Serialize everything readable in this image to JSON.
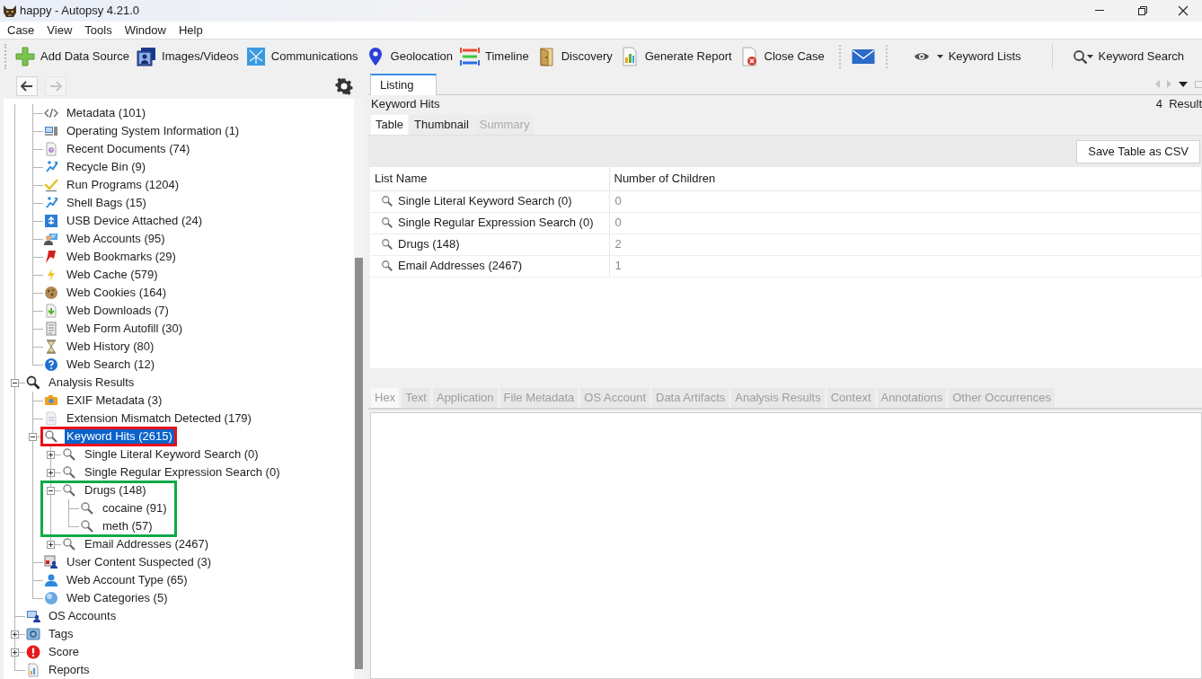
{
  "window": {
    "title": "happy - Autopsy 4.21.0"
  },
  "menu": [
    "Case",
    "View",
    "Tools",
    "Window",
    "Help"
  ],
  "toolbar": {
    "buttons": [
      "Add Data Source",
      "Images/Videos",
      "Communications",
      "Geolocation",
      "Timeline",
      "Discovery",
      "Generate Report",
      "Close Case"
    ],
    "keyword_buttons": [
      "Keyword Lists",
      "Keyword Search"
    ]
  },
  "navigation": {
    "back": {
      "disabled": false
    },
    "forward": {
      "disabled": true
    }
  },
  "tree": {
    "nodes": [
      {
        "children": [
          {
            "label": "Metadata (101)",
            "selected": false
          },
          {
            "label": "Operating System Information (1)",
            "selected": false
          },
          {
            "label": "Recent Documents (74)",
            "selected": false
          },
          {
            "label": "Recycle Bin (9)",
            "selected": false
          },
          {
            "label": "Run Programs (1204)",
            "selected": false
          },
          {
            "label": "Shell Bags (15)",
            "selected": false
          },
          {
            "label": "USB Device Attached (24)",
            "selected": false
          },
          {
            "label": "Web Accounts (95)",
            "selected": false
          },
          {
            "label": "Web Bookmarks (29)",
            "selected": false
          },
          {
            "label": "Web Cache (579)",
            "selected": false
          },
          {
            "label": "Web Cookies (164)",
            "selected": false
          },
          {
            "label": "Web Downloads (7)",
            "selected": false
          },
          {
            "label": "Web Form Autofill (30)",
            "selected": false
          },
          {
            "label": "Web History (80)",
            "selected": false
          },
          {
            "label": "Web Search (12)",
            "selected": false
          }
        ]
      },
      {
        "label": "Analysis Results",
        "expanded": true,
        "selected": false,
        "children": [
          {
            "label": "EXIF Metadata (3)",
            "selected": false
          },
          {
            "label": "Extension Mismatch Detected (179)",
            "selected": false
          },
          {
            "label": "Keyword Hits (2615)",
            "expanded": true,
            "selected": true,
            "annotation_box": {
              "kind": "row",
              "color": "#e8101a"
            },
            "children": [
              {
                "label": "Single Literal Keyword Search (0)",
                "expanded": false,
                "selected": false
              },
              {
                "label": "Single Regular Expression Search (0)",
                "expanded": false,
                "selected": false
              },
              {
                "label": "Drugs (148)",
                "expanded": true,
                "selected": false,
                "annotation_box": {
                  "kind": "branch",
                  "color": "#12a84a"
                },
                "children": [
                  {
                    "label": "cocaine (91)",
                    "selected": false
                  },
                  {
                    "label": "meth (57)",
                    "selected": false
                  }
                ]
              },
              {
                "label": "Email Addresses (2467)",
                "expanded": false,
                "selected": false
              }
            ]
          },
          {
            "label": "User Content Suspected (3)",
            "selected": false
          },
          {
            "label": "Web Account Type (65)",
            "selected": false
          },
          {
            "label": "Web Categories (5)",
            "selected": false
          }
        ]
      },
      {
        "label": "OS Accounts",
        "selected": false
      },
      {
        "label": "Tags",
        "expanded": false,
        "selected": false
      },
      {
        "label": "Score",
        "expanded": false,
        "selected": false
      },
      {
        "label": "Reports",
        "selected": false
      }
    ]
  },
  "listing": {
    "tabs": [
      {
        "label": "Listing",
        "selected": true
      }
    ],
    "title": "Keyword Hits",
    "result_count": "4  Result",
    "view_tabs": [
      {
        "label": "Table",
        "selected": true,
        "disabled": false
      },
      {
        "label": "Thumbnail",
        "selected": false,
        "disabled": false
      },
      {
        "label": "Summary",
        "selected": false,
        "disabled": true
      }
    ],
    "save_button": "Save Table as CSV",
    "table": {
      "columns": [
        "List Name",
        "Number of Children"
      ],
      "rows": [
        [
          "Single Literal Keyword Search (0)",
          "0"
        ],
        [
          "Single Regular Expression Search (0)",
          "0"
        ],
        [
          "Drugs (148)",
          "2"
        ],
        [
          "Email Addresses (2467)",
          "1"
        ]
      ]
    }
  },
  "content_viewer": {
    "tabs": [
      {
        "label": "Hex",
        "selected": true,
        "disabled": true
      },
      {
        "label": "Text",
        "selected": false,
        "disabled": true
      },
      {
        "label": "Application",
        "selected": false,
        "disabled": true
      },
      {
        "label": "File Metadata",
        "selected": false,
        "disabled": true
      },
      {
        "label": "OS Account",
        "selected": false,
        "disabled": true
      },
      {
        "label": "Data Artifacts",
        "selected": false,
        "disabled": true
      },
      {
        "label": "Analysis Results",
        "selected": false,
        "disabled": true
      },
      {
        "label": "Context",
        "selected": false,
        "disabled": true
      },
      {
        "label": "Annotations",
        "selected": false,
        "disabled": true
      },
      {
        "label": "Other Occurrences",
        "selected": false,
        "disabled": true
      }
    ]
  }
}
